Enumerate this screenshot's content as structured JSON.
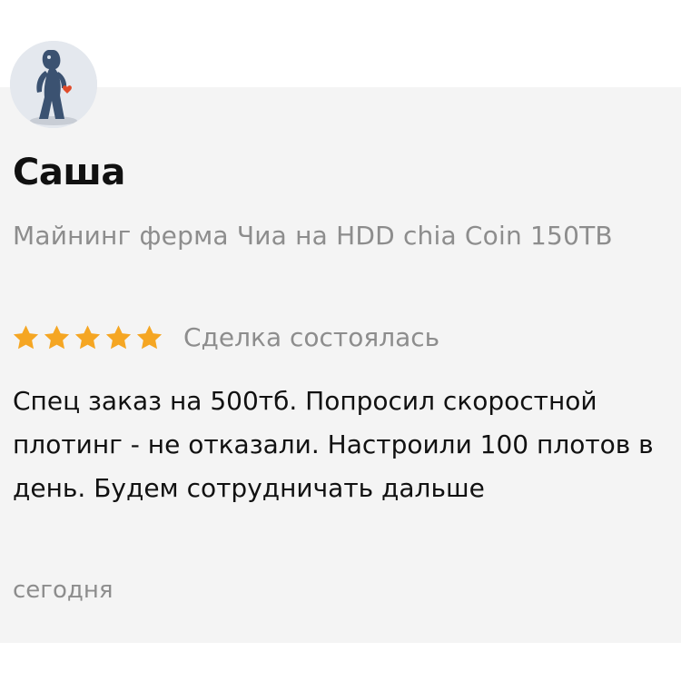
{
  "review": {
    "author_name": "Саша",
    "product_title": "Майнинг ферма Чиа на HDD chia Coin 150TB",
    "rating": 5,
    "rating_max": 5,
    "deal_status": "Сделка состоялась",
    "text": "Спец заказ на 500тб. Попросил скоростной плотинг - не отказали. Настроили 100 плотов в день. Будем сотрудничать дальше",
    "date": "сегодня",
    "avatar_icon": "user-avatar-figure-icon",
    "star_icon": "star-icon"
  },
  "colors": {
    "star": "#f5a623",
    "card_background": "#f4f4f4",
    "primary_text": "#111111",
    "secondary_text": "#8d8d8d"
  }
}
